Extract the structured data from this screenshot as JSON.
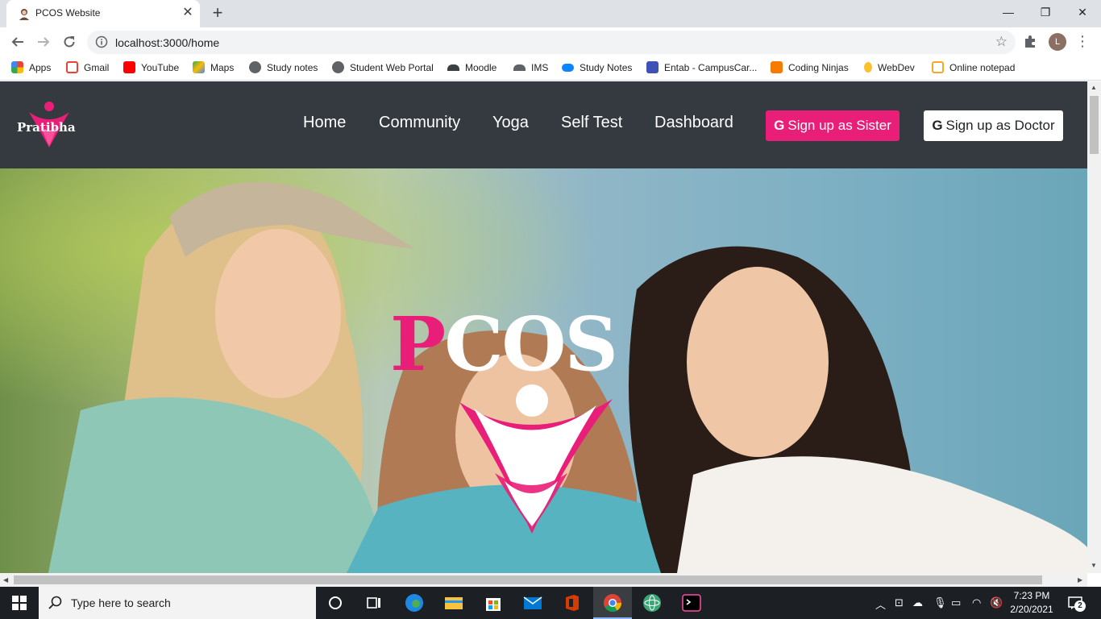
{
  "browser": {
    "tab_title": "PCOS Website",
    "tab_close": "✕",
    "new_tab": "+",
    "window_controls": {
      "minimize": "—",
      "restore": "❐",
      "close": "✕"
    },
    "url": "localhost:3000/home",
    "avatar_letter": "L"
  },
  "bookmarks": [
    {
      "label": "Apps",
      "color": "#4285f4"
    },
    {
      "label": "Gmail",
      "color": "#ea4335"
    },
    {
      "label": "YouTube",
      "color": "#ff0000"
    },
    {
      "label": "Maps",
      "color": "#34a853"
    },
    {
      "label": "Study notes",
      "color": "#5f6368"
    },
    {
      "label": "Student Web Portal",
      "color": "#5f6368"
    },
    {
      "label": "Moodle",
      "color": "#3c4043"
    },
    {
      "label": "IMS",
      "color": "#5f6368"
    },
    {
      "label": "Study Notes",
      "color": "#0a84ff"
    },
    {
      "label": "Entab - CampusCar...",
      "color": "#3f51b5"
    },
    {
      "label": "Coding Ninjas",
      "color": "#f57c00"
    },
    {
      "label": "WebDev",
      "color": "#fbc02d"
    },
    {
      "label": "Online notepad",
      "color": "#f9a825"
    }
  ],
  "site": {
    "brand": "Pratibha",
    "nav": [
      "Home",
      "Community",
      "Yoga",
      "Self Test",
      "Dashboard"
    ],
    "signup_sister": "Sign up as Sister",
    "signup_doctor": "Sign up as Doctor",
    "google_glyph": "G",
    "hero": {
      "title_first": "P",
      "title_rest": "COS"
    },
    "accent": "#e91e78",
    "nav_bg": "#343a40"
  },
  "taskbar": {
    "search_placeholder": "Type here to search",
    "time": "7:23 PM",
    "date": "2/20/2021",
    "notifications": "2"
  }
}
